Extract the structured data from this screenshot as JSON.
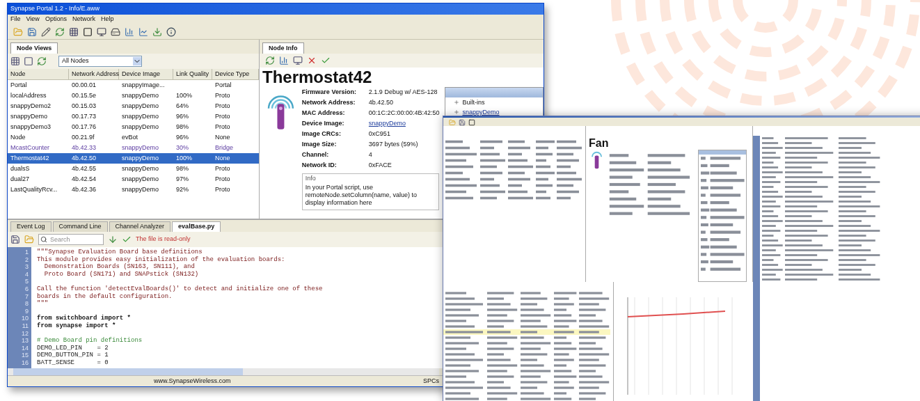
{
  "main_window": {
    "title": "Synapse Portal 1.2 - Info/E.aww",
    "menu": [
      "File",
      "View",
      "Options",
      "Network",
      "Help"
    ],
    "node_views": {
      "tab": "Node Views",
      "filter": "All Nodes",
      "columns": [
        "Node",
        "Network Address",
        "Device Image",
        "Link Quality",
        "Device Type"
      ],
      "rows": [
        {
          "cells": [
            "Portal",
            "00.00.01",
            "snappyImage...",
            "",
            "Portal"
          ],
          "selected": false,
          "inactive": false
        },
        {
          "cells": [
            "localAddress",
            "00.15.5e",
            "snappyDemo",
            "100%",
            "Proto"
          ],
          "selected": false,
          "inactive": false
        },
        {
          "cells": [
            "snappyDemo2",
            "00.15.03",
            "snappyDemo",
            "64%",
            "Proto"
          ],
          "selected": false,
          "inactive": false
        },
        {
          "cells": [
            "snappyDemo",
            "00.17.73",
            "snappyDemo",
            "96%",
            "Proto"
          ],
          "selected": false,
          "inactive": false
        },
        {
          "cells": [
            "snappyDemo3",
            "00.17.76",
            "snappyDemo",
            "98%",
            "Proto"
          ],
          "selected": false,
          "inactive": false
        },
        {
          "cells": [
            "Node",
            "00.21.9f",
            "evBot",
            "96%",
            "None"
          ],
          "selected": false,
          "inactive": false
        },
        {
          "cells": [
            "McastCounter",
            "4b.42.33",
            "snappyDemo",
            "30%",
            "Bridge"
          ],
          "selected": false,
          "inactive": true
        },
        {
          "cells": [
            "Thermostat42",
            "4b.42.50",
            "snappyDemo",
            "100%",
            "None"
          ],
          "selected": true,
          "inactive": false
        },
        {
          "cells": [
            "dualsS",
            "4b.42.55",
            "snappyDemo",
            "98%",
            "Proto"
          ],
          "selected": false,
          "inactive": false
        },
        {
          "cells": [
            "dual27",
            "4b.42.54",
            "snappyDemo",
            "97%",
            "Proto"
          ],
          "selected": false,
          "inactive": false
        },
        {
          "cells": [
            "LastQualityRcv...",
            "4b.42.36",
            "snappyDemo",
            "92%",
            "Proto"
          ],
          "selected": false,
          "inactive": false
        }
      ]
    },
    "node_info": {
      "tab": "Node Info",
      "name": "Thermostat42",
      "fields": [
        {
          "label": "Firmware Version:",
          "value": "2.1.9 Debug w/ AES-128",
          "link": false
        },
        {
          "label": "Network Address:",
          "value": "4b.42.50",
          "link": false
        },
        {
          "label": "MAC Address:",
          "value": "00:1C:2C:00:00:4B:42:50",
          "link": false
        },
        {
          "label": "Device Image:",
          "value": "snappyDemo",
          "link": true
        },
        {
          "label": "Image CRCs:",
          "value": "0xC951",
          "link": false
        },
        {
          "label": "Image Size:",
          "value": "3697 bytes (59%)",
          "link": false
        },
        {
          "label": "Channel:",
          "value": "4",
          "link": false
        },
        {
          "label": "Network ID:",
          "value": "0xFACE",
          "link": false
        }
      ],
      "info_label": "Info",
      "info_text": "In your Portal script, use remoteNode.setColumn(name, value) to display information here",
      "tree": [
        {
          "label": "Built-ins",
          "link": false
        },
        {
          "label": "snappyDemo",
          "link": true
        }
      ]
    },
    "bottom_tabs": [
      {
        "label": "Event Log",
        "selected": false
      },
      {
        "label": "Command Line",
        "selected": false
      },
      {
        "label": "Channel Analyzer",
        "selected": false
      },
      {
        "label": "evalBase.py",
        "selected": true
      }
    ],
    "search": {
      "placeholder": "Search"
    },
    "readonly_note": "The file is read-only",
    "code": [
      {
        "number": "1",
        "text": "\"\"\"Synapse Evaluation Board base definitions",
        "kind": "doc"
      },
      {
        "number": "2",
        "text": "This module provides easy initialization of the evaluation boards:",
        "kind": "doc"
      },
      {
        "number": "3",
        "text": "  Demonstration Boards (SN163, SN111), and",
        "kind": "doc"
      },
      {
        "number": "4",
        "text": "  Proto Board (SN171) and SNAPstick (SN132)",
        "kind": "doc"
      },
      {
        "number": "5"
      },
      {
        "number": "6",
        "text": "Call the function 'detectEvalBoards()' to detect and initialize one of these",
        "kind": "doc"
      },
      {
        "number": "7",
        "text": "boards in the default configuration.",
        "kind": "doc"
      },
      {
        "number": "8",
        "text": "\"\"\"",
        "kind": "doc"
      },
      {
        "number": "9"
      },
      {
        "number": "10",
        "text": "from switchboard import *",
        "kind": "keyword"
      },
      {
        "number": "11",
        "text": "from synapse import *",
        "kind": "keyword"
      },
      {
        "number": "12"
      },
      {
        "number": "13",
        "text": "# Demo Board pin definitions",
        "kind": "comment"
      },
      {
        "number": "14",
        "text": "DEMO_LED_PIN    = 2",
        "kind": "plain"
      },
      {
        "number": "15",
        "text": "DEMO_BUTTON_PIN = 1",
        "kind": "plain"
      },
      {
        "number": "16",
        "text": "BATT_SENSE      = 0",
        "kind": "plain"
      }
    ],
    "status": [
      "www.SynapseWireless.com",
      "SPCs"
    ]
  },
  "second_window": {
    "node_name": "Fan"
  }
}
